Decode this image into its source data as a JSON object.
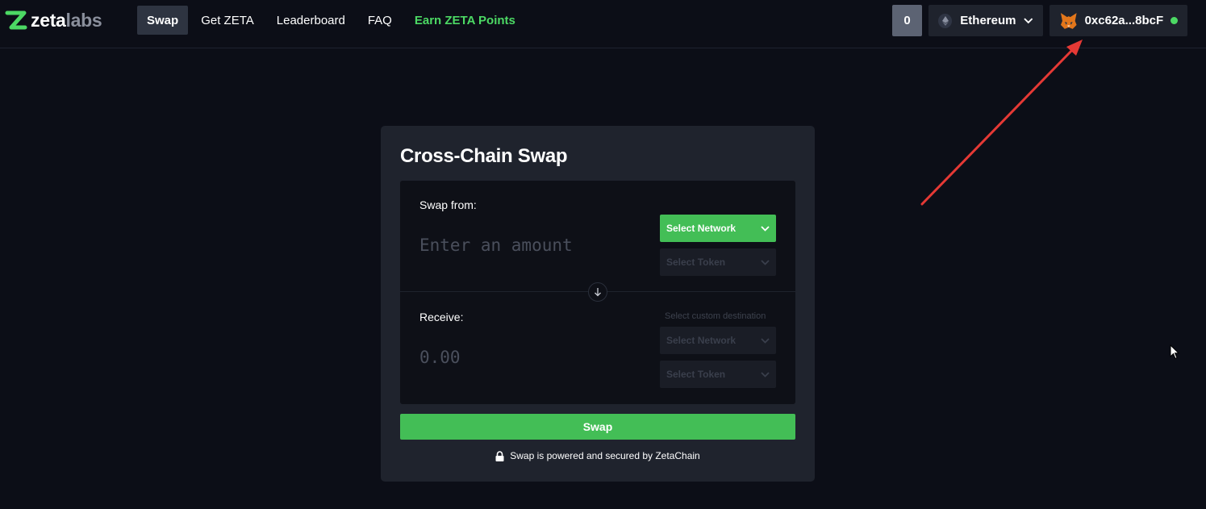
{
  "brand": {
    "name_part1": "zeta",
    "name_part2": "labs"
  },
  "nav": {
    "items": [
      {
        "label": "Swap",
        "active": true
      },
      {
        "label": "Get ZETA",
        "active": false
      },
      {
        "label": "Leaderboard",
        "active": false
      },
      {
        "label": "FAQ",
        "active": false
      }
    ],
    "points_label": "Earn ZETA Points"
  },
  "header": {
    "counter": "0",
    "network": {
      "label": "Ethereum",
      "icon": "ethereum-icon"
    },
    "wallet": {
      "address": "0xc62a...8bcF",
      "icon": "metamask-fox-icon",
      "status": "connected"
    }
  },
  "swap": {
    "title": "Cross-Chain Swap",
    "from": {
      "label": "Swap from:",
      "amount_placeholder": "Enter an amount",
      "network_label": "Select Network",
      "token_label": "Select Token"
    },
    "receive": {
      "label": "Receive:",
      "amount": "0.00",
      "custom_destination": "Select custom destination",
      "network_label": "Select Network",
      "token_label": "Select Token"
    },
    "button_label": "Swap",
    "footer": "Swap is powered and secured by ZetaChain"
  },
  "colors": {
    "background": "#0c0e17",
    "card": "#1f232d",
    "accent_green": "#43be56",
    "points_green": "#4cd964",
    "annotation_red": "#e53935"
  }
}
